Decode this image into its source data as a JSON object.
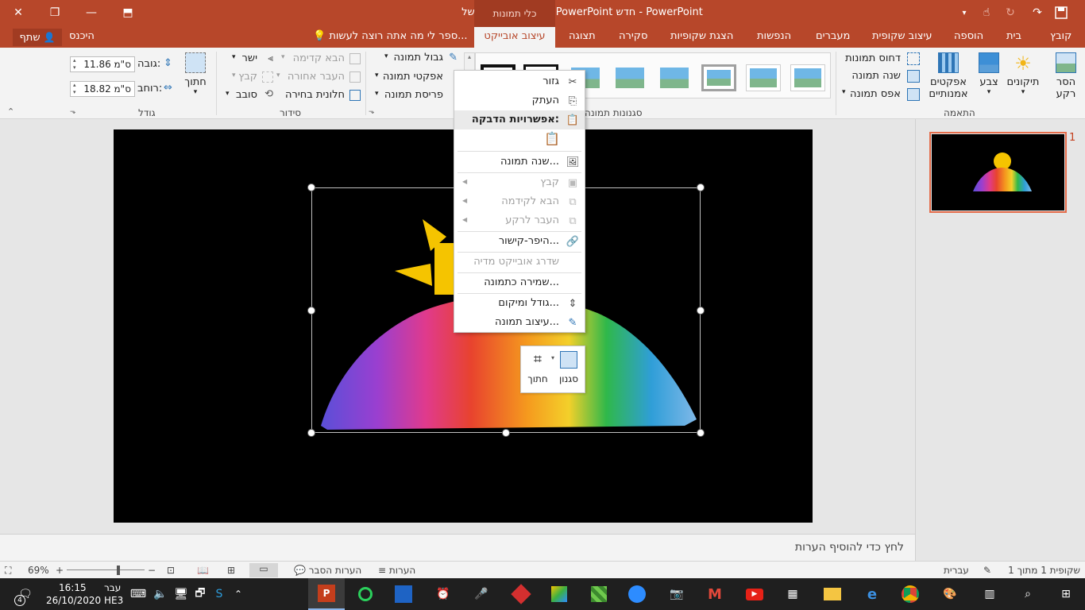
{
  "titlebar": {
    "title": "מצגת של Microsoft PowerPoint חדש - PowerPoint",
    "context_group": "כלי תמונות",
    "sign_in": "היכנס",
    "share": "שתף"
  },
  "tabs": {
    "file": "קובץ",
    "home": "בית",
    "insert": "הוספה",
    "design": "עיצוב שקופית",
    "transitions": "מעברים",
    "animations": "הנפשות",
    "slideshow": "הצגת שקופיות",
    "review": "סקירה",
    "view": "תצוגה",
    "format": "עיצוב אובייקט",
    "tellme": "ספר לי מה אתה רוצה לעשות..."
  },
  "ribbon": {
    "adjust": {
      "group": "התאמה",
      "remove_bg": "הסר",
      "remove_bg2": "רקע",
      "corrections": "תיקונים",
      "color": "צבע",
      "artistic": "אפקטים",
      "artistic2": "אמנותיים",
      "compress": "דחוס תמונות",
      "change": "שנה תמונה",
      "reset": "אפס תמונה"
    },
    "styles": {
      "group": "סגנונות תמונה",
      "border": "גבול תמונה",
      "effects": "אפקטי תמונה",
      "layout": "פריסת תמונה"
    },
    "arrange": {
      "group": "סידור",
      "bring_forward": "הבא קדימה",
      "send_backward": "העבר אחורה",
      "selection_pane": "חלונית בחירה",
      "align": "ישר",
      "group_btn": "קבץ",
      "rotate": "סובב"
    },
    "size": {
      "group": "גודל",
      "crop": "חתוך",
      "height_label": "גובה:",
      "height_value": "11.86 ס\"מ",
      "width_label": "רוחב:",
      "width_value": "18.82 ס\"מ"
    }
  },
  "context_menu": {
    "cut": "גזור",
    "copy": "העתק",
    "paste_options": "אפשרויות הדבקה:",
    "change_picture": "שנה תמונה...",
    "group": "קבץ",
    "bring_forward": "הבא לקידמה",
    "send_backward": "העבר לרקע",
    "hyperlink": "היפר-קישור...",
    "upgrade_media": "שדרג אובייקט מדיה",
    "save_as_picture": "שמירה כתמונה...",
    "size_position": "גודל ומיקום...",
    "format_picture": "עיצוב תמונה..."
  },
  "mini_toolbar": {
    "style": "סגנון",
    "crop": "חתוך"
  },
  "thumbnail": {
    "number": "1"
  },
  "notes": {
    "placeholder": "לחץ כדי להוסיף הערות"
  },
  "status": {
    "slide": "שקופית 1 מתוך 1",
    "language": "עברית",
    "notes": "הערות",
    "comments": "הערות הסבר",
    "zoom": "69%"
  },
  "taskbar": {
    "time": "16:15",
    "date": "26/10/2020",
    "lang1": "עבר",
    "lang2": "HE3",
    "badge": "4"
  },
  "colors": {
    "accent": "#b7472a",
    "ribbon_bg": "#f3f3f3",
    "taskbar": "#1f1f1f"
  }
}
